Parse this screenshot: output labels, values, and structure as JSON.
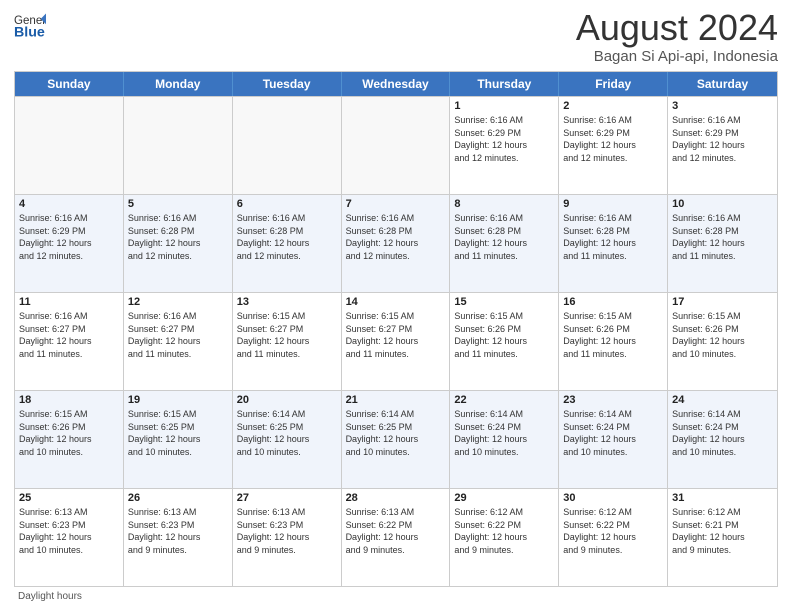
{
  "header": {
    "logo_general": "General",
    "logo_blue": "Blue",
    "month_year": "August 2024",
    "location": "Bagan Si Api-api, Indonesia"
  },
  "weekdays": [
    "Sunday",
    "Monday",
    "Tuesday",
    "Wednesday",
    "Thursday",
    "Friday",
    "Saturday"
  ],
  "footer": {
    "daylight_label": "Daylight hours"
  },
  "rows": [
    {
      "alt": false,
      "cells": [
        {
          "day": "",
          "info": ""
        },
        {
          "day": "",
          "info": ""
        },
        {
          "day": "",
          "info": ""
        },
        {
          "day": "",
          "info": ""
        },
        {
          "day": "1",
          "info": "Sunrise: 6:16 AM\nSunset: 6:29 PM\nDaylight: 12 hours\nand 12 minutes."
        },
        {
          "day": "2",
          "info": "Sunrise: 6:16 AM\nSunset: 6:29 PM\nDaylight: 12 hours\nand 12 minutes."
        },
        {
          "day": "3",
          "info": "Sunrise: 6:16 AM\nSunset: 6:29 PM\nDaylight: 12 hours\nand 12 minutes."
        }
      ]
    },
    {
      "alt": true,
      "cells": [
        {
          "day": "4",
          "info": "Sunrise: 6:16 AM\nSunset: 6:29 PM\nDaylight: 12 hours\nand 12 minutes."
        },
        {
          "day": "5",
          "info": "Sunrise: 6:16 AM\nSunset: 6:28 PM\nDaylight: 12 hours\nand 12 minutes."
        },
        {
          "day": "6",
          "info": "Sunrise: 6:16 AM\nSunset: 6:28 PM\nDaylight: 12 hours\nand 12 minutes."
        },
        {
          "day": "7",
          "info": "Sunrise: 6:16 AM\nSunset: 6:28 PM\nDaylight: 12 hours\nand 12 minutes."
        },
        {
          "day": "8",
          "info": "Sunrise: 6:16 AM\nSunset: 6:28 PM\nDaylight: 12 hours\nand 11 minutes."
        },
        {
          "day": "9",
          "info": "Sunrise: 6:16 AM\nSunset: 6:28 PM\nDaylight: 12 hours\nand 11 minutes."
        },
        {
          "day": "10",
          "info": "Sunrise: 6:16 AM\nSunset: 6:28 PM\nDaylight: 12 hours\nand 11 minutes."
        }
      ]
    },
    {
      "alt": false,
      "cells": [
        {
          "day": "11",
          "info": "Sunrise: 6:16 AM\nSunset: 6:27 PM\nDaylight: 12 hours\nand 11 minutes."
        },
        {
          "day": "12",
          "info": "Sunrise: 6:16 AM\nSunset: 6:27 PM\nDaylight: 12 hours\nand 11 minutes."
        },
        {
          "day": "13",
          "info": "Sunrise: 6:15 AM\nSunset: 6:27 PM\nDaylight: 12 hours\nand 11 minutes."
        },
        {
          "day": "14",
          "info": "Sunrise: 6:15 AM\nSunset: 6:27 PM\nDaylight: 12 hours\nand 11 minutes."
        },
        {
          "day": "15",
          "info": "Sunrise: 6:15 AM\nSunset: 6:26 PM\nDaylight: 12 hours\nand 11 minutes."
        },
        {
          "day": "16",
          "info": "Sunrise: 6:15 AM\nSunset: 6:26 PM\nDaylight: 12 hours\nand 11 minutes."
        },
        {
          "day": "17",
          "info": "Sunrise: 6:15 AM\nSunset: 6:26 PM\nDaylight: 12 hours\nand 10 minutes."
        }
      ]
    },
    {
      "alt": true,
      "cells": [
        {
          "day": "18",
          "info": "Sunrise: 6:15 AM\nSunset: 6:26 PM\nDaylight: 12 hours\nand 10 minutes."
        },
        {
          "day": "19",
          "info": "Sunrise: 6:15 AM\nSunset: 6:25 PM\nDaylight: 12 hours\nand 10 minutes."
        },
        {
          "day": "20",
          "info": "Sunrise: 6:14 AM\nSunset: 6:25 PM\nDaylight: 12 hours\nand 10 minutes."
        },
        {
          "day": "21",
          "info": "Sunrise: 6:14 AM\nSunset: 6:25 PM\nDaylight: 12 hours\nand 10 minutes."
        },
        {
          "day": "22",
          "info": "Sunrise: 6:14 AM\nSunset: 6:24 PM\nDaylight: 12 hours\nand 10 minutes."
        },
        {
          "day": "23",
          "info": "Sunrise: 6:14 AM\nSunset: 6:24 PM\nDaylight: 12 hours\nand 10 minutes."
        },
        {
          "day": "24",
          "info": "Sunrise: 6:14 AM\nSunset: 6:24 PM\nDaylight: 12 hours\nand 10 minutes."
        }
      ]
    },
    {
      "alt": false,
      "cells": [
        {
          "day": "25",
          "info": "Sunrise: 6:13 AM\nSunset: 6:23 PM\nDaylight: 12 hours\nand 10 minutes."
        },
        {
          "day": "26",
          "info": "Sunrise: 6:13 AM\nSunset: 6:23 PM\nDaylight: 12 hours\nand 9 minutes."
        },
        {
          "day": "27",
          "info": "Sunrise: 6:13 AM\nSunset: 6:23 PM\nDaylight: 12 hours\nand 9 minutes."
        },
        {
          "day": "28",
          "info": "Sunrise: 6:13 AM\nSunset: 6:22 PM\nDaylight: 12 hours\nand 9 minutes."
        },
        {
          "day": "29",
          "info": "Sunrise: 6:12 AM\nSunset: 6:22 PM\nDaylight: 12 hours\nand 9 minutes."
        },
        {
          "day": "30",
          "info": "Sunrise: 6:12 AM\nSunset: 6:22 PM\nDaylight: 12 hours\nand 9 minutes."
        },
        {
          "day": "31",
          "info": "Sunrise: 6:12 AM\nSunset: 6:21 PM\nDaylight: 12 hours\nand 9 minutes."
        }
      ]
    }
  ]
}
